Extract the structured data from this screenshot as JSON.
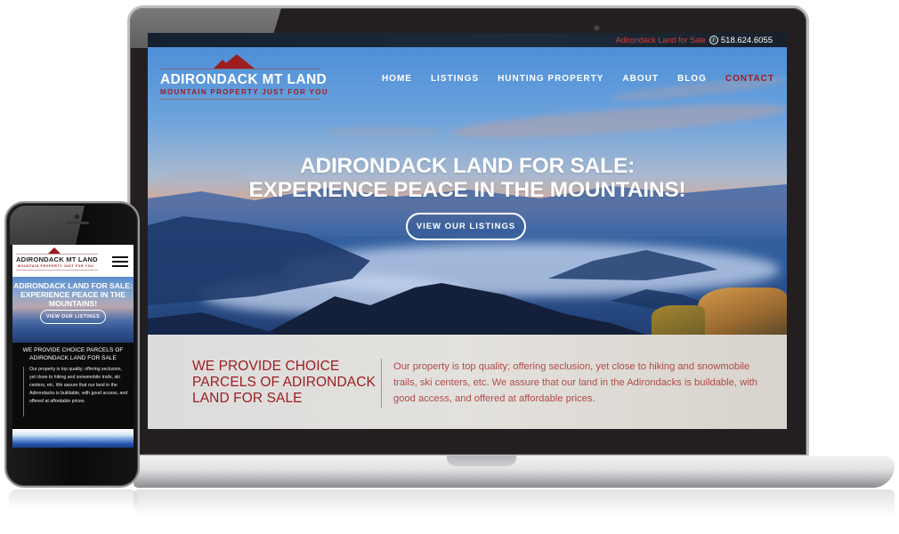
{
  "desktop": {
    "topbar": {
      "tagline": "Adirondack Land for Sale",
      "phone_icon": "phone-icon",
      "phone": "518.624.6055"
    },
    "logo": {
      "title": "ADIRONDACK MT LAND",
      "subtitle": "MOUNTAIN PROPERTY JUST FOR YOU",
      "icon": "mountain-peak-icon"
    },
    "nav": {
      "items": [
        {
          "label": "HOME"
        },
        {
          "label": "LISTINGS"
        },
        {
          "label": "HUNTING PROPERTY"
        },
        {
          "label": "ABOUT"
        },
        {
          "label": "BLOG"
        },
        {
          "label": "CONTACT",
          "active": true
        }
      ]
    },
    "hero": {
      "title_line1": "ADIRONDACK LAND FOR SALE:",
      "title_line2": "EXPERIENCE PEACE IN THE MOUNTAINS!",
      "cta_label": "VIEW OUR LISTINGS"
    },
    "info": {
      "heading_line1": "WE PROVIDE CHOICE",
      "heading_line2": "PARCELS OF ADIRONDACK",
      "heading_line3": "LAND FOR SALE",
      "body": "Our property is top quality; offering seclusion, yet close to hiking and snowmobile trails, ski centers, etc. We assure that our land in the Adirondacks is buildable, with good access, and offered at affordable prices."
    }
  },
  "mobile": {
    "logo": {
      "title": "ADIRONDACK MT LAND",
      "subtitle": "MOUNTAIN PROPERTY JUST FOR YOU"
    },
    "menu_icon": "hamburger-menu-icon",
    "hero": {
      "title_line1": "ADIRONDACK LAND FOR SALE:",
      "title_line2": "EXPERIENCE PEACE IN THE",
      "title_line3": "MOUNTAINS!",
      "cta_label": "VIEW OUR LISTINGS"
    },
    "info": {
      "heading_line1": "WE PROVIDE CHOICE PARCELS OF",
      "heading_line2": "ADIRONDACK LAND FOR SALE",
      "body": "Our property is top quality; offering seclusion, yet close to hiking and snowmobile trails, ski centers, etc. We assure that our land in the Adirondacks is buildable, with good access, and offered at affordable prices."
    }
  },
  "colors": {
    "brand_red": "#9c1c1f",
    "topbar_bg": "#1e2a38",
    "info_bg": "#e0dfdc"
  }
}
